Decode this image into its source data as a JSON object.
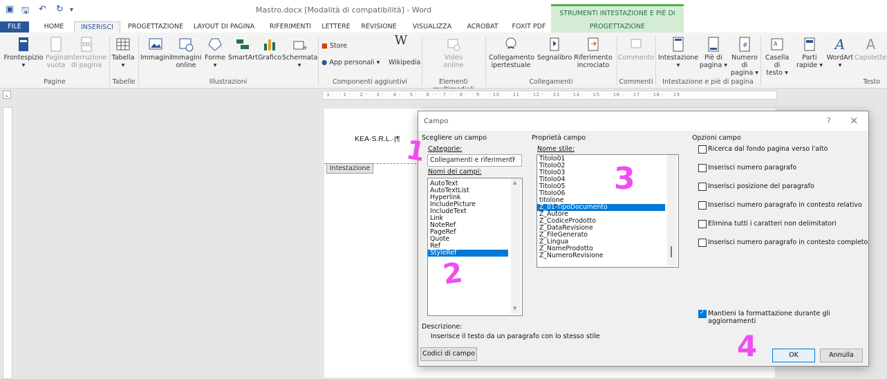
{
  "window": {
    "title": "Mastro.docx [Modalità di compatibilità] - Word",
    "context_title": "STRUMENTI INTESTAZIONE E PIÈ DI PAGINA"
  },
  "tabs": [
    "FILE",
    "HOME",
    "INSERISCI",
    "PROGETTAZIONE",
    "LAYOUT DI PAGINA",
    "RIFERIMENTI",
    "LETTERE",
    "REVISIONE",
    "VISUALIZZA",
    "ACROBAT",
    "FOXIT PDF",
    "PROGETTAZIONE"
  ],
  "ribbon": {
    "frontespizio": "Frontespizio",
    "pagina_vuota": [
      "Pagina",
      "vuota"
    ],
    "interruzione": [
      "Interruzione",
      "di pagina"
    ],
    "tabella": "Tabella",
    "immagini": "Immagini",
    "immagini_online": [
      "Immagini",
      "online"
    ],
    "forme": "Forme",
    "smartart": "SmartArt",
    "grafico": "Grafico",
    "schermata": "Schermata",
    "store": "Store",
    "app_personali": "App personali",
    "wikipedia": "Wikipedia",
    "video": [
      "Video",
      "online"
    ],
    "collegamento": [
      "Collegamento",
      "ipertestuale"
    ],
    "segnalibro": "Segnalibro",
    "riferimento": [
      "Riferimento",
      "incrociato"
    ],
    "commento": "Commento",
    "intestazione": "Intestazione",
    "pie_pagina": [
      "Piè di",
      "pagina"
    ],
    "numero_pagina": [
      "Numero di",
      "pagina"
    ],
    "casella_testo": [
      "Casella di",
      "testo"
    ],
    "parti_rapide": [
      "Parti",
      "rapide"
    ],
    "wordart": "WordArt",
    "capolettera": "Capolettera",
    "groups": {
      "pagine": "Pagine",
      "tabelle": "Tabelle",
      "illustrazioni": "Illustrazioni",
      "componenti": "Componenti aggiuntivi",
      "multimediali": "Elementi multimediali",
      "collegamenti": "Collegamenti",
      "commenti": "Commenti",
      "intestazione_pie": "Intestazione e piè di pagina",
      "testo": "Testo"
    }
  },
  "ruler_text": "· 1 · · · 1 · · · 2 · · · 3 · · · 4 · · · 5 · · · 6 · · · 7 · · · 8 · · · 9 · · · 10 · · · 11 · · · 12 · · · 13 · · · 14 · · · 15 · · · 16 · · · 17 · · · 18 · · · 19",
  "document": {
    "header_text": "KEA·S.R.L.·|¶",
    "header_label": "Intestazione"
  },
  "dialog": {
    "title": "Campo",
    "help": "?",
    "close": "×",
    "choose_field": "Scegliere un campo",
    "categories_label": "Categorie:",
    "category_value": "Collegamenti e riferimenti",
    "field_names_label": "Nomi dei campi:",
    "field_names": [
      "AutoText",
      "AutoTextList",
      "Hyperlink",
      "IncludePicture",
      "IncludeText",
      "Link",
      "NoteRef",
      "PageRef",
      "Quote",
      "Ref",
      "StyleRef"
    ],
    "field_selected": "StyleRef",
    "field_props": "Proprietà campo",
    "style_name_label": "Nome stile:",
    "styles": [
      "Titolo01",
      "Titolo02",
      "Titolo03",
      "Titolo04",
      "Titolo05",
      "Titolo06",
      "titolone",
      "Z_01-TipoDocumento",
      "Z_Autore",
      "Z_CodiceProdotto",
      "Z_DataRevisione",
      "Z_FileGenerato",
      "Z_Lingua",
      "Z_NomeProdotto",
      "Z_NumeroRevisione"
    ],
    "style_selected": "Z_01-TipoDocumento",
    "field_options": "Opzioni campo",
    "options": [
      {
        "label": "Ricerca dal fondo pagina verso l'alto",
        "checked": false
      },
      {
        "label": "Inserisci numero paragrafo",
        "checked": false
      },
      {
        "label": "Inserisci posizione del paragrafo",
        "checked": false
      },
      {
        "label": "Inserisci numero paragrafo in contesto relativo",
        "checked": false
      },
      {
        "label": "Elimina tutti i caratteri non delimitatori",
        "checked": false
      },
      {
        "label": "Inserisci numero paragrafo in contesto completo",
        "checked": false
      }
    ],
    "keep_format": {
      "label": "Mantieni la formattazione durante gli aggiornamenti",
      "checked": true
    },
    "description_label": "Descrizione:",
    "description_text": "Inserisce il testo da un paragrafo con lo stesso stile",
    "field_codes_button": "Codici di campo",
    "ok_button": "OK",
    "cancel_button": "Annulla"
  },
  "annotations": [
    "1",
    "2",
    "3",
    "4"
  ],
  "colors": {
    "word_blue": "#2b579a",
    "selection": "#0078d7",
    "annotation_pink": "#f04df0",
    "context_green": "#217346"
  }
}
